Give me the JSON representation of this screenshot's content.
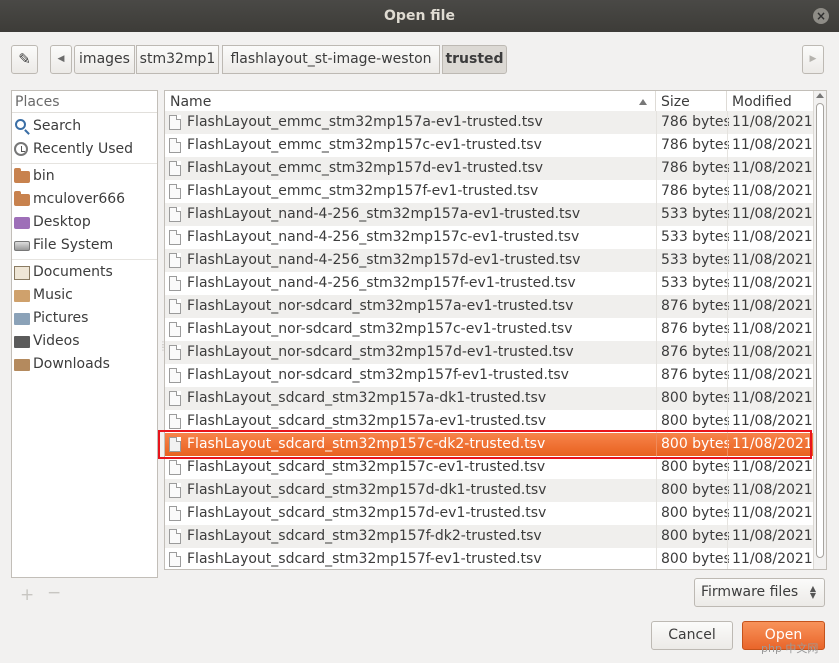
{
  "window": {
    "title": "Open file",
    "close_glyph": "×"
  },
  "path_bar": {
    "edit_icon": "pencil-icon",
    "crumbs": [
      "images",
      "stm32mp1",
      "flashlayout_st-image-weston",
      "trusted"
    ],
    "active_crumb": "trusted"
  },
  "places": {
    "header": "Places",
    "items": [
      {
        "label": "Search",
        "icon": "search-icon"
      },
      {
        "label": "Recently Used",
        "icon": "clock-icon"
      },
      {
        "label": "bin",
        "icon": "folder-icon"
      },
      {
        "label": "mculover666",
        "icon": "home-folder-icon"
      },
      {
        "label": "Desktop",
        "icon": "desktop-icon"
      },
      {
        "label": "File System",
        "icon": "drive-icon"
      },
      {
        "label": "Documents",
        "icon": "documents-folder-icon"
      },
      {
        "label": "Music",
        "icon": "music-folder-icon"
      },
      {
        "label": "Pictures",
        "icon": "pictures-folder-icon"
      },
      {
        "label": "Videos",
        "icon": "videos-folder-icon"
      },
      {
        "label": "Downloads",
        "icon": "downloads-folder-icon"
      }
    ],
    "add_glyph": "+",
    "remove_glyph": "−"
  },
  "file_list": {
    "columns": {
      "name": "Name",
      "size": "Size",
      "modified": "Modified"
    },
    "sort_column": "Name",
    "sort_direction": "ascending",
    "selected_row": 14,
    "rows": [
      {
        "name": "FlashLayout_emmc_stm32mp157a-ev1-trusted.tsv",
        "size": "786 bytes",
        "modified": "11/08/2021"
      },
      {
        "name": "FlashLayout_emmc_stm32mp157c-ev1-trusted.tsv",
        "size": "786 bytes",
        "modified": "11/08/2021"
      },
      {
        "name": "FlashLayout_emmc_stm32mp157d-ev1-trusted.tsv",
        "size": "786 bytes",
        "modified": "11/08/2021"
      },
      {
        "name": "FlashLayout_emmc_stm32mp157f-ev1-trusted.tsv",
        "size": "786 bytes",
        "modified": "11/08/2021"
      },
      {
        "name": "FlashLayout_nand-4-256_stm32mp157a-ev1-trusted.tsv",
        "size": "533 bytes",
        "modified": "11/08/2021"
      },
      {
        "name": "FlashLayout_nand-4-256_stm32mp157c-ev1-trusted.tsv",
        "size": "533 bytes",
        "modified": "11/08/2021"
      },
      {
        "name": "FlashLayout_nand-4-256_stm32mp157d-ev1-trusted.tsv",
        "size": "533 bytes",
        "modified": "11/08/2021"
      },
      {
        "name": "FlashLayout_nand-4-256_stm32mp157f-ev1-trusted.tsv",
        "size": "533 bytes",
        "modified": "11/08/2021"
      },
      {
        "name": "FlashLayout_nor-sdcard_stm32mp157a-ev1-trusted.tsv",
        "size": "876 bytes",
        "modified": "11/08/2021"
      },
      {
        "name": "FlashLayout_nor-sdcard_stm32mp157c-ev1-trusted.tsv",
        "size": "876 bytes",
        "modified": "11/08/2021"
      },
      {
        "name": "FlashLayout_nor-sdcard_stm32mp157d-ev1-trusted.tsv",
        "size": "876 bytes",
        "modified": "11/08/2021"
      },
      {
        "name": "FlashLayout_nor-sdcard_stm32mp157f-ev1-trusted.tsv",
        "size": "876 bytes",
        "modified": "11/08/2021"
      },
      {
        "name": "FlashLayout_sdcard_stm32mp157a-dk1-trusted.tsv",
        "size": "800 bytes",
        "modified": "11/08/2021"
      },
      {
        "name": "FlashLayout_sdcard_stm32mp157a-ev1-trusted.tsv",
        "size": "800 bytes",
        "modified": "11/08/2021"
      },
      {
        "name": "FlashLayout_sdcard_stm32mp157c-dk2-trusted.tsv",
        "size": "800 bytes",
        "modified": "11/08/2021"
      },
      {
        "name": "FlashLayout_sdcard_stm32mp157c-ev1-trusted.tsv",
        "size": "800 bytes",
        "modified": "11/08/2021"
      },
      {
        "name": "FlashLayout_sdcard_stm32mp157d-dk1-trusted.tsv",
        "size": "800 bytes",
        "modified": "11/08/2021"
      },
      {
        "name": "FlashLayout_sdcard_stm32mp157d-ev1-trusted.tsv",
        "size": "800 bytes",
        "modified": "11/08/2021"
      },
      {
        "name": "FlashLayout_sdcard_stm32mp157f-dk2-trusted.tsv",
        "size": "800 bytes",
        "modified": "11/08/2021"
      },
      {
        "name": "FlashLayout_sdcard_stm32mp157f-ev1-trusted.tsv",
        "size": "800 bytes",
        "modified": "11/08/2021"
      }
    ]
  },
  "filter": {
    "selected": "Firmware files"
  },
  "buttons": {
    "cancel": "Cancel",
    "open": "Open"
  },
  "colors": {
    "selection": "#e9652a",
    "titlebar": "#3d3c38",
    "highlight_box": "#e8141c"
  },
  "watermark": "php 中文网"
}
